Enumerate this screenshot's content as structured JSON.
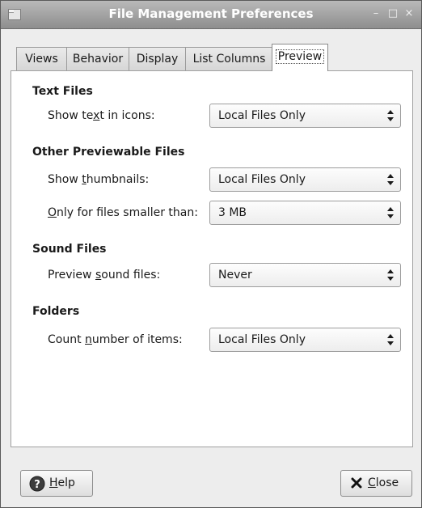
{
  "window": {
    "title": "File Management Preferences"
  },
  "tabs": [
    {
      "label": "Views"
    },
    {
      "label": "Behavior"
    },
    {
      "label": "Display"
    },
    {
      "label": "List Columns"
    },
    {
      "label": "Preview",
      "active": true
    }
  ],
  "sections": {
    "text_files": {
      "heading": "Text Files",
      "rows": [
        {
          "label_before": "Show te",
          "mnemonic": "x",
          "label_after": "t in icons:",
          "value": "Local Files Only"
        }
      ]
    },
    "other_files": {
      "heading": "Other Previewable Files",
      "rows": [
        {
          "label_before": "Show ",
          "mnemonic": "t",
          "label_after": "humbnails:",
          "value": "Local Files Only"
        },
        {
          "label_before": "",
          "mnemonic": "O",
          "label_after": "nly for files smaller than:",
          "value": "3 MB"
        }
      ]
    },
    "sound_files": {
      "heading": "Sound Files",
      "rows": [
        {
          "label_before": "Preview ",
          "mnemonic": "s",
          "label_after": "ound files:",
          "value": "Never"
        }
      ]
    },
    "folders": {
      "heading": "Folders",
      "rows": [
        {
          "label_before": "Count ",
          "mnemonic": "n",
          "label_after": "umber of items:",
          "value": "Local Files Only"
        }
      ]
    }
  },
  "buttons": {
    "help": {
      "mnemonic": "H",
      "rest": "elp",
      "icon": "help-icon"
    },
    "close": {
      "mnemonic": "C",
      "rest": "lose",
      "icon": "close-x-icon"
    }
  }
}
